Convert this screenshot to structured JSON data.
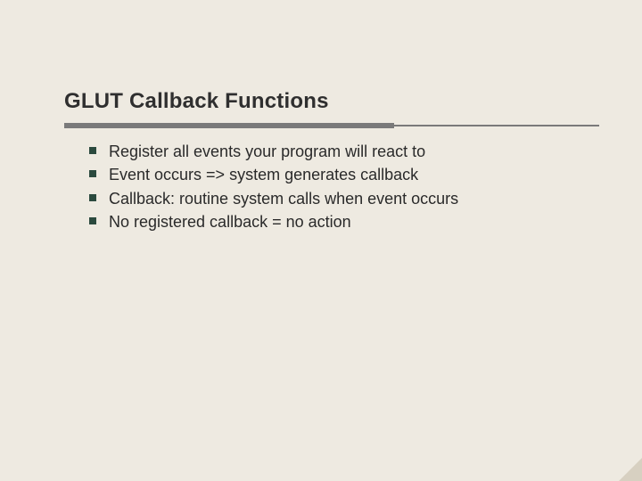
{
  "title": "GLUT Callback Functions",
  "bullets": [
    "Register all events your program will react to",
    "Event occurs  => system generates callback",
    "Callback: routine system calls when event occurs",
    "No registered callback = no action"
  ],
  "colors": {
    "background": "#eeeae1",
    "text": "#2a2a2a",
    "rule": "#7a7a7a",
    "bullet_square": "#2b4a3e"
  }
}
